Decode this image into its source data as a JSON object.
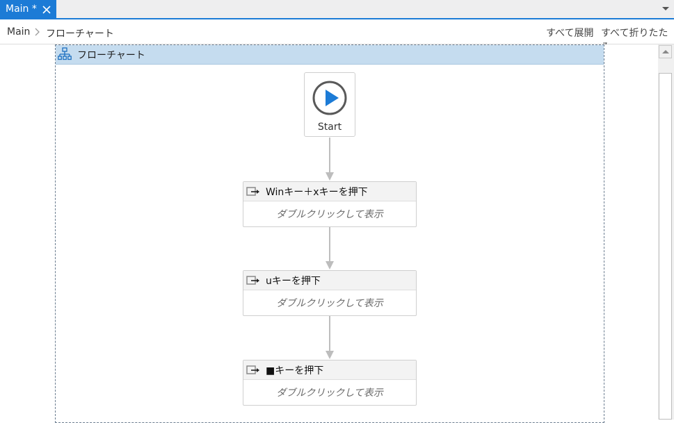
{
  "tab": {
    "title": "Main *",
    "close_icon": "close-icon"
  },
  "breadcrumb": {
    "root": "Main",
    "current": "フローチャート"
  },
  "toolbar": {
    "expand_all": "すべて展開",
    "collapse_all": "すべて折りたたみ"
  },
  "flowchart": {
    "title": "フローチャート",
    "icon": "flowchart-icon",
    "start_label": "Start",
    "activities": [
      {
        "title": "Winキー＋xキーを押下",
        "body": "ダブルクリックして表示"
      },
      {
        "title": "uキーを押下",
        "body": "ダブルクリックして表示"
      },
      {
        "title": "■キーを押下",
        "body": "ダブルクリックして表示"
      }
    ]
  },
  "colors": {
    "accent": "#1c7bd6",
    "header_bg": "#c5dcef",
    "start_play": "#1c7bd6",
    "connector": "#bdbdbd"
  }
}
